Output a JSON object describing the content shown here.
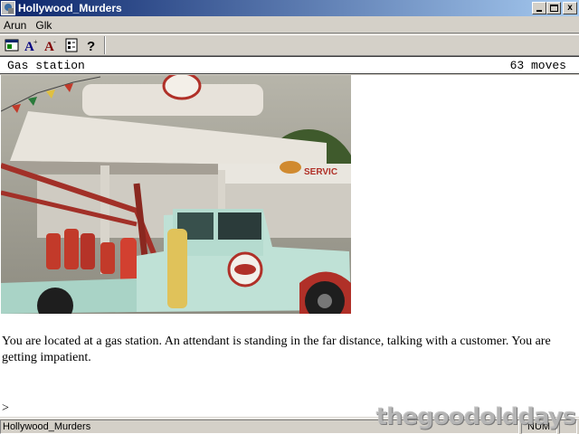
{
  "window": {
    "title": "Hollywood_Murders",
    "buttons": {
      "minimize": "_",
      "maximize": "□",
      "close": "x"
    }
  },
  "menubar": {
    "items": [
      {
        "label": "Arun"
      },
      {
        "label": "Glk"
      }
    ]
  },
  "toolbar": {
    "icons": [
      "window-icon",
      "font-larger-icon",
      "font-smaller-icon",
      "options-icon",
      "help-icon"
    ]
  },
  "status": {
    "location": "Gas station",
    "moves": "63 moves"
  },
  "story": {
    "text": "You are located at a gas station. An attendant is standing in the far distance, talking with a customer. You are getting impatient.",
    "prompt": ">"
  },
  "bottombar": {
    "label": "Hollywood_Murders",
    "num": "NUM"
  },
  "watermark": "thegoodolddays"
}
